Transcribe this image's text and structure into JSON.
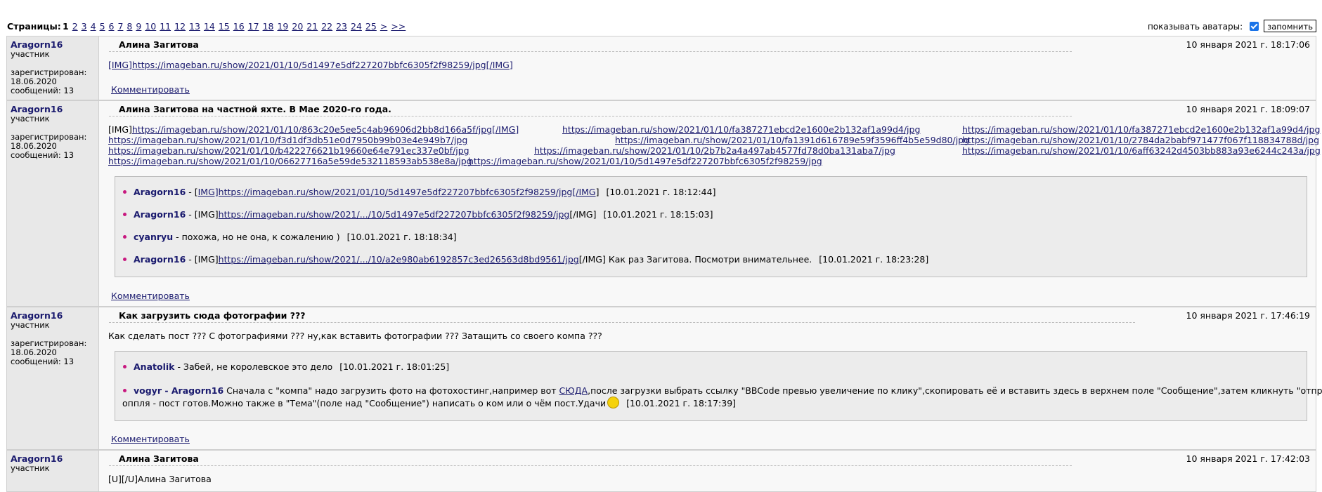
{
  "topbar": {
    "pages_label": "Страницы:",
    "current_page": "1",
    "pages": [
      "2",
      "3",
      "4",
      "5",
      "6",
      "7",
      "8",
      "9",
      "10",
      "11",
      "12",
      "13",
      "14",
      "15",
      "16",
      "17",
      "18",
      "19",
      "20",
      "21",
      "22",
      "23",
      "24",
      "25",
      ">",
      ">>"
    ],
    "show_avatars_label": "показывать аватары:",
    "show_avatars_checked": true,
    "remember_button": "запомнить"
  },
  "posts": [
    {
      "author": {
        "nick": "Aragorn16",
        "role": "участник",
        "reg_label": "зарегистрирован:",
        "reg_date": "18.06.2020",
        "msgs": "сообщений: 13"
      },
      "title": "Алина Загитова",
      "date": "10 января 2021 г. 18:17:06",
      "text_prefix": "[IMG]",
      "text_link": "https://imageban.ru/show/2021/01/10/5d1497e5df227207bbfc6305f2f98259/jpg[/IMG]",
      "comment_label": "Комментировать"
    },
    {
      "author": {
        "nick": "Aragorn16",
        "role": "участник",
        "reg_label": "зарегистрирован:",
        "reg_date": "18.06.2020",
        "msgs": "сообщений: 13"
      },
      "title": "Алина Загитова на частной яхте. В Мае 2020-го года.",
      "date": "10 января 2021 г. 18:09:07",
      "line1_prefix": "[IMG]",
      "line1": [
        "https://imageban.ru/show/2021/01/10/863c20e5ee5c4ab96906d2bb8d166a5f/jpg[/IMG]",
        "https://imageban.ru/show/2021/01/10/fa387271ebcd2e1600e2b132af1a99d4/jpg",
        "https://imageban.ru/show/2021/01/10/fa387271ebcd2e1600e2b132af1a99d4/jpg"
      ],
      "line2": [
        "https://imageban.ru/show/2021/01/10/f3d1df3db51e0d7950b99b03e4e949b7/jpg",
        "https://imageban.ru/show/2021/01/10/fa1391d616789e59f3596ff4b5e59d80/jpg",
        "https://imageban.ru/show/2021/01/10/2784da2babf971477f067f118834788d/jpg"
      ],
      "line3": [
        "https://imageban.ru/show/2021/01/10/b422276621b19660e64e791ec337e0bf/jpg",
        "https://imageban.ru/show/2021/01/10/2b7b2a4a497ab4577fd78d0ba131aba7/jpg",
        "https://imageban.ru/show/2021/01/10/6aff63242d4503bb883a93e6244c243a/jpg"
      ],
      "line4": [
        "https://imageban.ru/show/2021/01/10/06627716a5e59de532118593ab538e8a/jpg",
        "https://imageban.ru/show/2021/01/10/5d1497e5df227207bbfc6305f2f98259/jpg"
      ],
      "comments": [
        {
          "who": "Aragorn16",
          "pre": " - [",
          "link": "IMG]https://imageban.ru/show/2021/01/10/5d1497e5df227207bbfc6305f2f98259/jpg[/IMG",
          "post": "]",
          "ts": "[10.01.2021 г. 18:12:44]"
        },
        {
          "who": "Aragorn16",
          "pre": " - [IMG]",
          "link": "https://imageban.ru/show/2021/.../10/5d1497e5df227207bbfc6305f2f98259/jpg",
          "post": "[/IMG]",
          "ts": "[10.01.2021 г. 18:15:03]"
        },
        {
          "who": "cyanryu",
          "pre": " - похожа, но не она, к сожалению )",
          "link": "",
          "post": "",
          "ts": "[10.01.2021 г. 18:18:34]"
        },
        {
          "who": "Aragorn16",
          "pre": " - [IMG]",
          "link": "https://imageban.ru/show/2021/.../10/a2e980ab6192857c3ed26563d8bd9561/jpg",
          "post": "[/IMG] Как раз Загитова. Посмотри внимательнее.",
          "ts": "[10.01.2021 г. 18:23:28]"
        }
      ],
      "comment_label": "Комментировать"
    },
    {
      "author": {
        "nick": "Aragorn16",
        "role": "участник",
        "reg_label": "зарегистрирован:",
        "reg_date": "18.06.2020",
        "msgs": "сообщений: 13"
      },
      "title": "Как загрузить сюда фотографии ???",
      "date": "10 января 2021 г. 17:46:19",
      "text": "Как сделать пост ??? С фотографиями ??? ну,как вставить фотографии ??? Затащить со своего компа ???",
      "comments": [
        {
          "who": "Anatolik",
          "pre": " - Забей, не королевское это дело",
          "ts": "[10.01.2021 г. 18:01:25]"
        },
        {
          "who": "vogyr - Aragorn16",
          "pre": " Сначала с \"компа\" надо загрузить фото на фотохостинг,например вот ",
          "link": "СЮДА",
          "post": ",после загрузки выбрать ссылку \"BBCode превью увеличение по клику\",скопировать её и вставить здесь в верхнем поле \"Сообщение\",затем кликнуть \"отправить\", и",
          "line2": "оппля - пост готов.Можно также в \"Тема\"(поле над \"Сообщение\") написать о ком или о чём пост.Удачи",
          "ts": "[10.01.2021 г. 18:17:39]"
        }
      ],
      "comment_label": "Комментировать"
    },
    {
      "author": {
        "nick": "Aragorn16",
        "role": "участник"
      },
      "title": "Алина Загитова",
      "date": "10 января 2021 г. 17:42:03",
      "text": "[U][/U]Алина Загитова"
    }
  ]
}
